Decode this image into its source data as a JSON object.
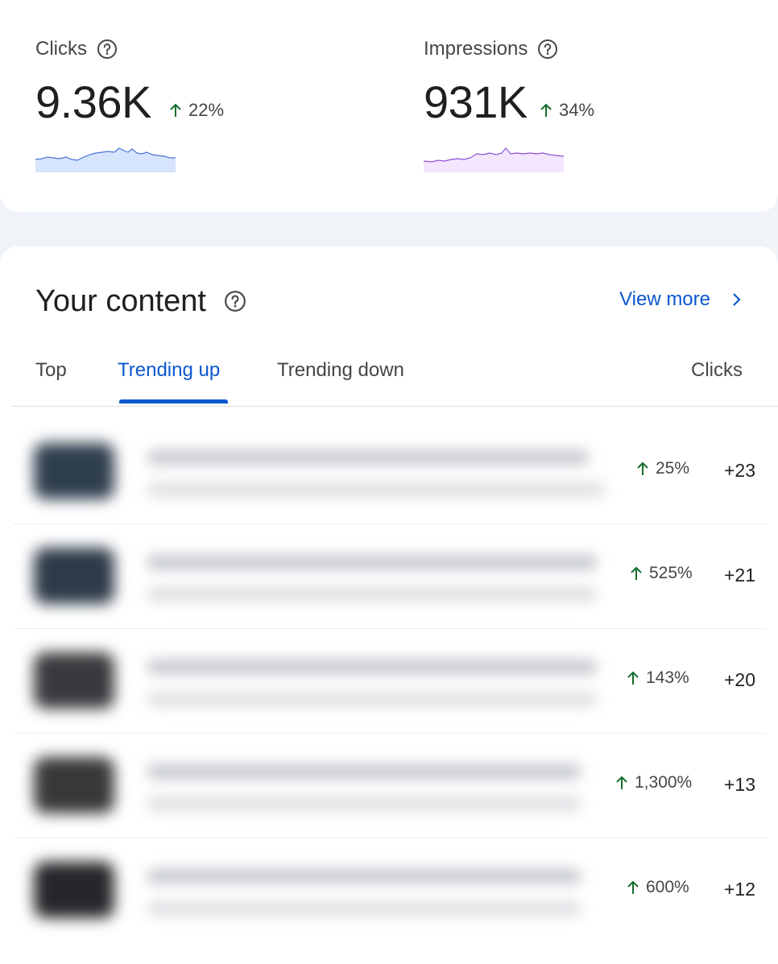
{
  "metrics": [
    {
      "label": "Clicks",
      "value": "9.36K",
      "change": "22%",
      "color_stroke": "#4a76d8",
      "color_fill": "#d6e4fd"
    },
    {
      "label": "Impressions",
      "value": "931K",
      "change": "34%",
      "color_stroke": "#8e4fd6",
      "color_fill": "#f3e6fd"
    }
  ],
  "content": {
    "title": "Your content",
    "view_more": "View more",
    "tabs": [
      "Top",
      "Trending up",
      "Trending down"
    ],
    "active_tab": "Trending up",
    "column_header": "Clicks",
    "rows": [
      {
        "change": "25%",
        "delta": "+23"
      },
      {
        "change": "525%",
        "delta": "+21"
      },
      {
        "change": "143%",
        "delta": "+20"
      },
      {
        "change": "1,300%",
        "delta": "+13"
      },
      {
        "change": "600%",
        "delta": "+12"
      }
    ]
  },
  "colors": {
    "accent": "#0b57d0",
    "positive": "#146c2e",
    "background": "#f0f4f9",
    "card": "#ffffff"
  }
}
